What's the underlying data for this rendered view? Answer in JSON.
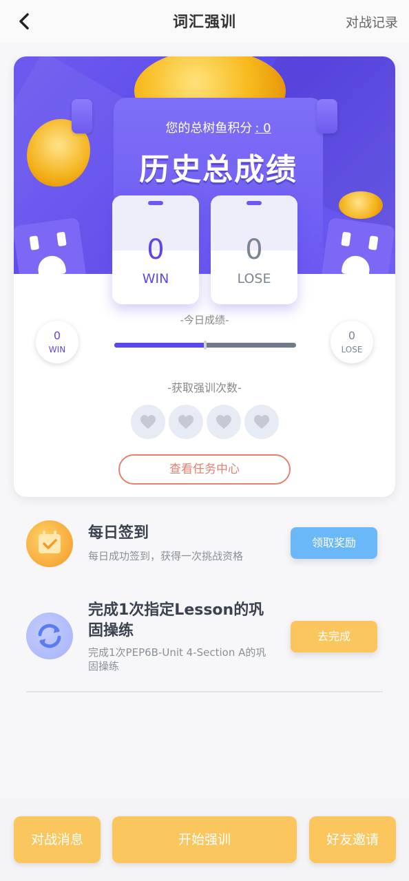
{
  "header": {
    "title": "词汇强训",
    "record_label": "对战记录"
  },
  "summary": {
    "total_label": "您的总树鱼积分",
    "total_value": "0",
    "history_title": "历史总成绩",
    "win_count": "0",
    "win_label": "WIN",
    "lose_count": "0",
    "lose_label": "LOSE"
  },
  "today": {
    "label": "-今日成绩-",
    "win_count": "0",
    "win_label": "WIN",
    "lose_count": "0",
    "lose_label": "LOSE",
    "progress_fraction": 0.5
  },
  "obtain": {
    "label": "-获取强训次数-",
    "hearts_total": 4,
    "hearts_filled": 0,
    "task_center_label": "查看任务中心"
  },
  "tasks": [
    {
      "title": "每日签到",
      "desc": "每日成功签到，获得一次挑战资格",
      "button": "领取奖励",
      "icon": "calendar-check-icon",
      "button_color": "#6ab8f7"
    },
    {
      "title": "完成1次指定Lesson的巩固操练",
      "desc": "完成1次PEP6B-Unit 4-Section A的巩固操练",
      "button": "去完成",
      "icon": "refresh-icon",
      "button_color": "#fcc65e"
    }
  ],
  "bottom": {
    "messages_label": "对战消息",
    "start_label": "开始强训",
    "invite_label": "好友邀请"
  },
  "colors": {
    "accent_purple": "#5b48ea",
    "accent_yellow": "#fcc65e",
    "accent_blue": "#6ab8f7",
    "task_center_red": "#e67f6c"
  }
}
